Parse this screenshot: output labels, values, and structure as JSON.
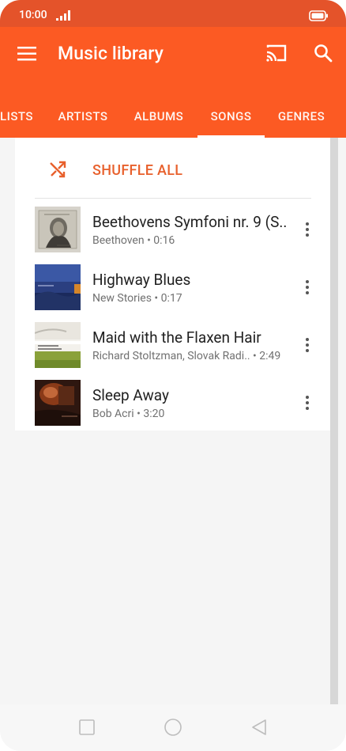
{
  "status_bar": {
    "time": "10:00",
    "signal_icon": "signal-icon",
    "battery_icon": "battery-icon"
  },
  "app_bar": {
    "title": "Music library",
    "menu_icon": "menu-icon",
    "cast_icon": "cast-icon",
    "search_icon": "search-icon"
  },
  "tabs": [
    {
      "label": "LISTS"
    },
    {
      "label": "ARTISTS"
    },
    {
      "label": "ALBUMS"
    },
    {
      "label": "SONGS",
      "selected": true
    },
    {
      "label": "GENRES"
    }
  ],
  "shuffle": {
    "label": "SHUFFLE ALL",
    "icon": "shuffle-icon"
  },
  "songs": [
    {
      "title": "Beethovens Symfoni nr. 9 (S..",
      "subtitle": "Beethoven • 0:16"
    },
    {
      "title": "Highway Blues",
      "subtitle": "New Stories • 0:17"
    },
    {
      "title": "Maid with the Flaxen Hair",
      "subtitle": "Richard Stoltzman, Slovak Radi..  • 2:49"
    },
    {
      "title": "Sleep Away",
      "subtitle": "Bob Acri • 3:20"
    }
  ],
  "nav": {
    "recents_icon": "square-icon",
    "home_icon": "circle-icon",
    "back_icon": "triangle-back-icon"
  },
  "colors": {
    "status_bar": "#e4532a",
    "app_bar": "#fc5a23",
    "accent": "#e8602c",
    "background": "#f5f5f5"
  }
}
